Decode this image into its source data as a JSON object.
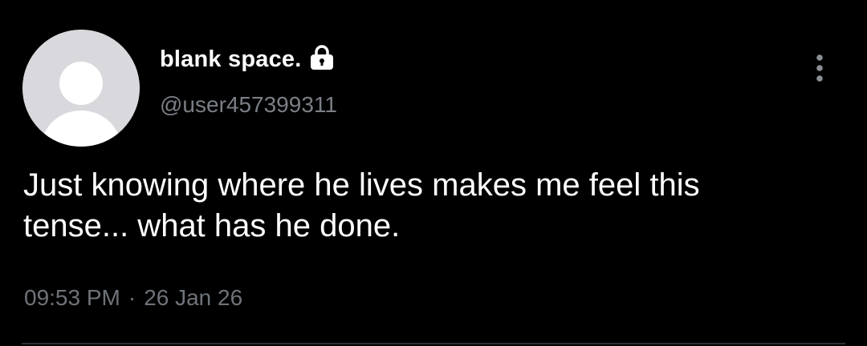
{
  "tweet": {
    "display_name": "blank space.",
    "handle": "@user457399311",
    "text": "Just knowing where he lives makes me feel this\ntense... what has he done.",
    "time": "09:53 PM",
    "separator": "·",
    "date": "26 Jan 26"
  },
  "icons": {
    "avatar": "default-user-avatar",
    "lock": "lock-icon",
    "more": "more-vertical-icon"
  },
  "colors": {
    "background": "#000000",
    "text": "#ffffff",
    "secondary_text": "#6e7379",
    "avatar_bg": "#d9d9dd",
    "divider": "#2c2f33"
  }
}
